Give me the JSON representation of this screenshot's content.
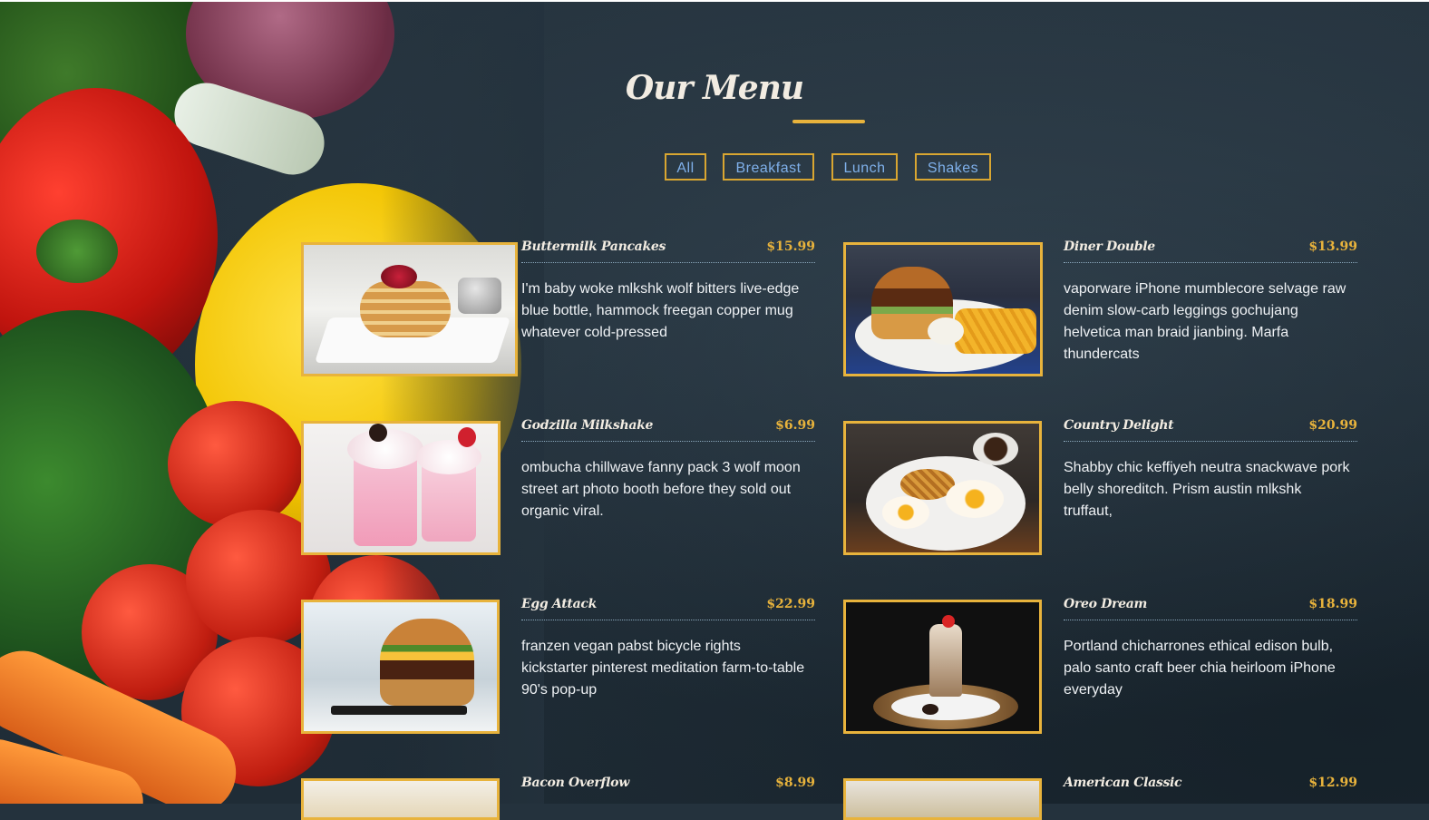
{
  "page": {
    "title": "Our Menu"
  },
  "filters": [
    {
      "label": "All"
    },
    {
      "label": "Breakfast"
    },
    {
      "label": "Lunch"
    },
    {
      "label": "Shakes"
    }
  ],
  "items": [
    {
      "name": "Buttermilk Pancakes",
      "price": "$15.99",
      "desc": "I'm baby woke mlkshk wolf bitters live-edge blue bottle, hammock freegan copper mug whatever cold-pressed"
    },
    {
      "name": "Diner Double",
      "price": "$13.99",
      "desc": "vaporware iPhone mumblecore selvage raw denim slow-carb leggings gochujang helvetica man braid jianbing. Marfa thundercats"
    },
    {
      "name": "Godzilla Milkshake",
      "price": "$6.99",
      "desc": "ombucha chillwave fanny pack 3 wolf moon street art photo booth before they sold out organic viral."
    },
    {
      "name": "Country Delight",
      "price": "$20.99",
      "desc": "Shabby chic keffiyeh neutra snackwave pork belly shoreditch. Prism austin mlkshk truffaut,"
    },
    {
      "name": "Egg Attack",
      "price": "$22.99",
      "desc": "franzen vegan pabst bicycle rights kickstarter pinterest meditation farm-to-table 90's pop-up"
    },
    {
      "name": "Oreo Dream",
      "price": "$18.99",
      "desc": "Portland chicharrones ethical edison bulb, palo santo craft beer chia heirloom iPhone everyday"
    },
    {
      "name": "Bacon Overflow",
      "price": "$8.99",
      "desc": ""
    },
    {
      "name": "American Classic",
      "price": "$12.99",
      "desc": ""
    }
  ],
  "colors": {
    "accent": "#e8b33c",
    "filter_text": "#7fb0ea",
    "background": "#24323d"
  }
}
